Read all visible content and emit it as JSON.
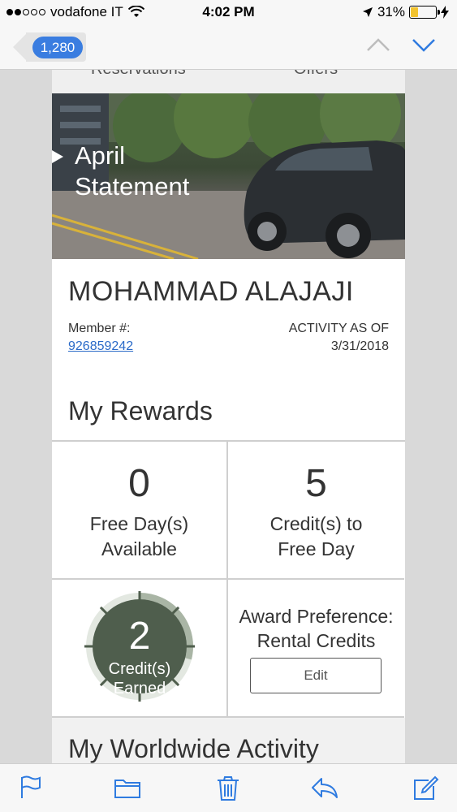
{
  "status_bar": {
    "carrier": "vodafone IT",
    "time": "4:02 PM",
    "battery_percent": "31%",
    "battery_level": 0.31,
    "signal_bars_filled": 2,
    "signal_bars_total": 5
  },
  "navbar": {
    "back_count": "1,280",
    "accent_color": "#3a7de0"
  },
  "email": {
    "top_nav": [
      "Reservations",
      "Offers"
    ],
    "hero_title_line1": "April",
    "hero_title_line2": "Statement",
    "member_name": "MOHAMMAD ALAJAJI",
    "member_label": "Member #:",
    "member_number": "926859242",
    "activity_label": "ACTIVITY AS OF",
    "activity_date": "3/31/2018",
    "rewards_title": "My Rewards",
    "free_days_value": "0",
    "free_days_label_line1": "Free Day(s)",
    "free_days_label_line2": "Available",
    "credits_to_free_value": "5",
    "credits_to_free_label_line1": "Credit(s) to",
    "credits_to_free_label_line2": "Free Day",
    "credits_earned_value": "2",
    "credits_earned_label_line1": "Credit(s)",
    "credits_earned_label_line2": "Earned",
    "credits_progress_fraction": 0.29,
    "award_label_line1": "Award Preference:",
    "award_label_line2": "Rental Credits",
    "edit_label": "Edit",
    "worldwide_title": "My Worldwide Activity",
    "gauge_color": "#4f5e4d"
  },
  "toolbar": {
    "icons": [
      "flag-icon",
      "folder-icon",
      "trash-icon",
      "reply-icon",
      "compose-icon"
    ],
    "icon_color": "#2f7be0"
  }
}
